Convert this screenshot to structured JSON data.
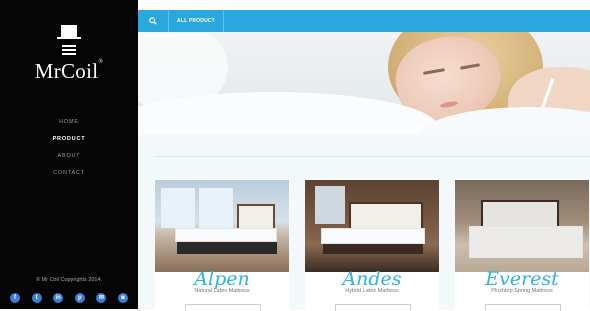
{
  "brand": {
    "name": "MrCoil",
    "mark": "®"
  },
  "nav": {
    "items": [
      {
        "label": "HOME",
        "active": false
      },
      {
        "label": "PRODUCT",
        "active": true
      },
      {
        "label": "ABOUT",
        "active": false
      },
      {
        "label": "CONTACT",
        "active": false
      }
    ]
  },
  "footer": {
    "copyright": "© Mr Coil Copyrights 2014.",
    "social": [
      {
        "icon": "facebook-icon",
        "glyph": "f"
      },
      {
        "icon": "twitter-icon",
        "glyph": "t"
      },
      {
        "icon": "linkedin-icon",
        "glyph": "in"
      },
      {
        "icon": "pinterest-icon",
        "glyph": "p"
      },
      {
        "icon": "email-icon",
        "glyph": "✉"
      },
      {
        "icon": "instagram-icon",
        "glyph": "◙"
      }
    ]
  },
  "topbar": {
    "search_icon": "search-icon",
    "all_product_label": "ALL PRODUCT"
  },
  "products": [
    {
      "name": "Alpen",
      "subtitle": "Natural Latex Mattress"
    },
    {
      "name": "Andes",
      "subtitle": "Hybrid Latex Mattress"
    },
    {
      "name": "Everest",
      "subtitle": "Plushtop Spring Mattress"
    }
  ],
  "colors": {
    "accent": "#29a8e0",
    "sidebar": "#050505",
    "product_name": "#2fb0e6",
    "social": "#3b7dd8"
  }
}
